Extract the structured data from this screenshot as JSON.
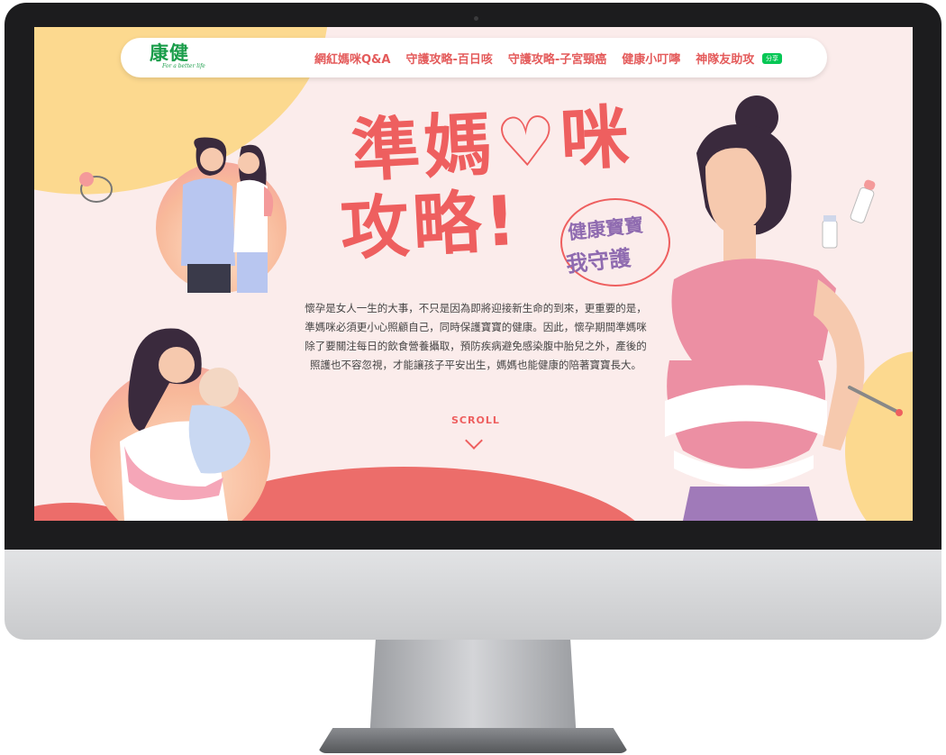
{
  "logo": {
    "text": "康健",
    "tagline": "For a better life"
  },
  "nav": {
    "items": [
      "網紅媽咪Q&A",
      "守護攻略-百日咳",
      "守護攻略-子宮頸癌",
      "健康小叮嚀",
      "神隊友助攻"
    ],
    "share_label": "分享"
  },
  "hero": {
    "title_line1": "準媽♡咪",
    "title_line2": "攻略!",
    "bubble_line1": "健康寶寶",
    "bubble_line2": "我守護",
    "description": "懷孕是女人一生的大事，不只是因為即將迎接新生命的到來，更重要的是，準媽咪必須更小心照顧自己，同時保護寶寶的健康。因此，懷孕期間準媽咪除了要關注每日的飲食營養攝取，預防疾病避免感染腹中胎兒之外，產後的照護也不容忽視，才能讓孩子平安出生，媽媽也能健康的陪著寶寶長大。",
    "scroll_label": "SCROLL"
  },
  "colors": {
    "accent": "#ee5f5f",
    "purple": "#8f6bb0",
    "line_green": "#06c755",
    "background": "#fbeceb"
  }
}
